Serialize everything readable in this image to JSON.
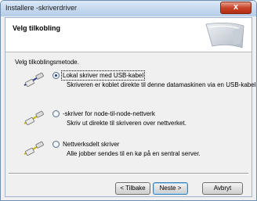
{
  "window": {
    "title": "Installere -skriverdriver",
    "close_label": "x"
  },
  "header": {
    "title": "Velg tilkobling"
  },
  "main": {
    "method_label": "Velg tilkoblingsmetode.",
    "options": [
      {
        "label": "Lokal skriver med USB-kabel",
        "description": "Skriveren er koblet direkte til denne datamaskinen via en USB-kabel.",
        "selected": true,
        "icon": "usb-cable-icon"
      },
      {
        "label": "-skriver for node-til-node-nettverk",
        "description": "Skriv ut direkte til skriveren over nettverket.",
        "selected": false,
        "icon": "network-cable-icon"
      },
      {
        "label": "Nettverksdelt skriver",
        "description": "Alle jobber sendes til en kø på en sentral server.",
        "selected": false,
        "icon": "shared-network-cable-icon"
      }
    ]
  },
  "footer": {
    "back_label": "< Tilbake",
    "next_label": "Neste >",
    "cancel_label": "Avbryt"
  },
  "colors": {
    "titlebar": "#c5d8ee",
    "close_button": "#c7432a",
    "dialog_background": "#f0f0f0"
  }
}
